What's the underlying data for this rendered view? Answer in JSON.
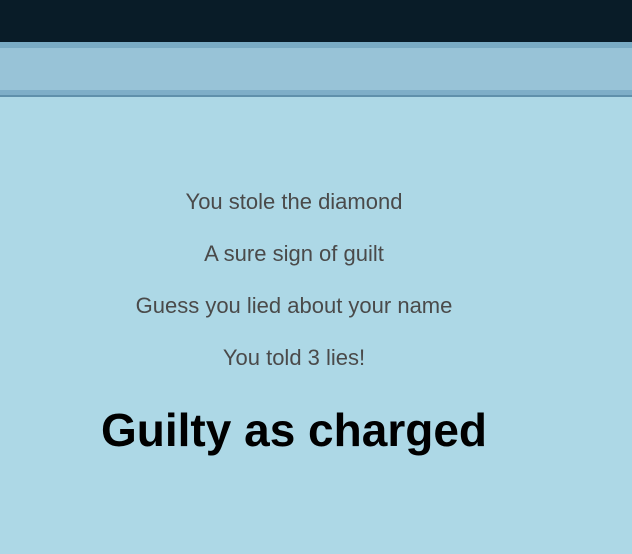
{
  "messages": [
    "You stole the diamond",
    "A sure sign of guilt",
    "Guess you lied about your name",
    "You told 3 lies!"
  ],
  "verdict": "Guilty as charged",
  "colors": {
    "background": "#add8e6",
    "top_bar": "#091c28",
    "sub_bar": "#98c3d7",
    "message_text": "#4a4a4a",
    "verdict_text": "#000000"
  }
}
